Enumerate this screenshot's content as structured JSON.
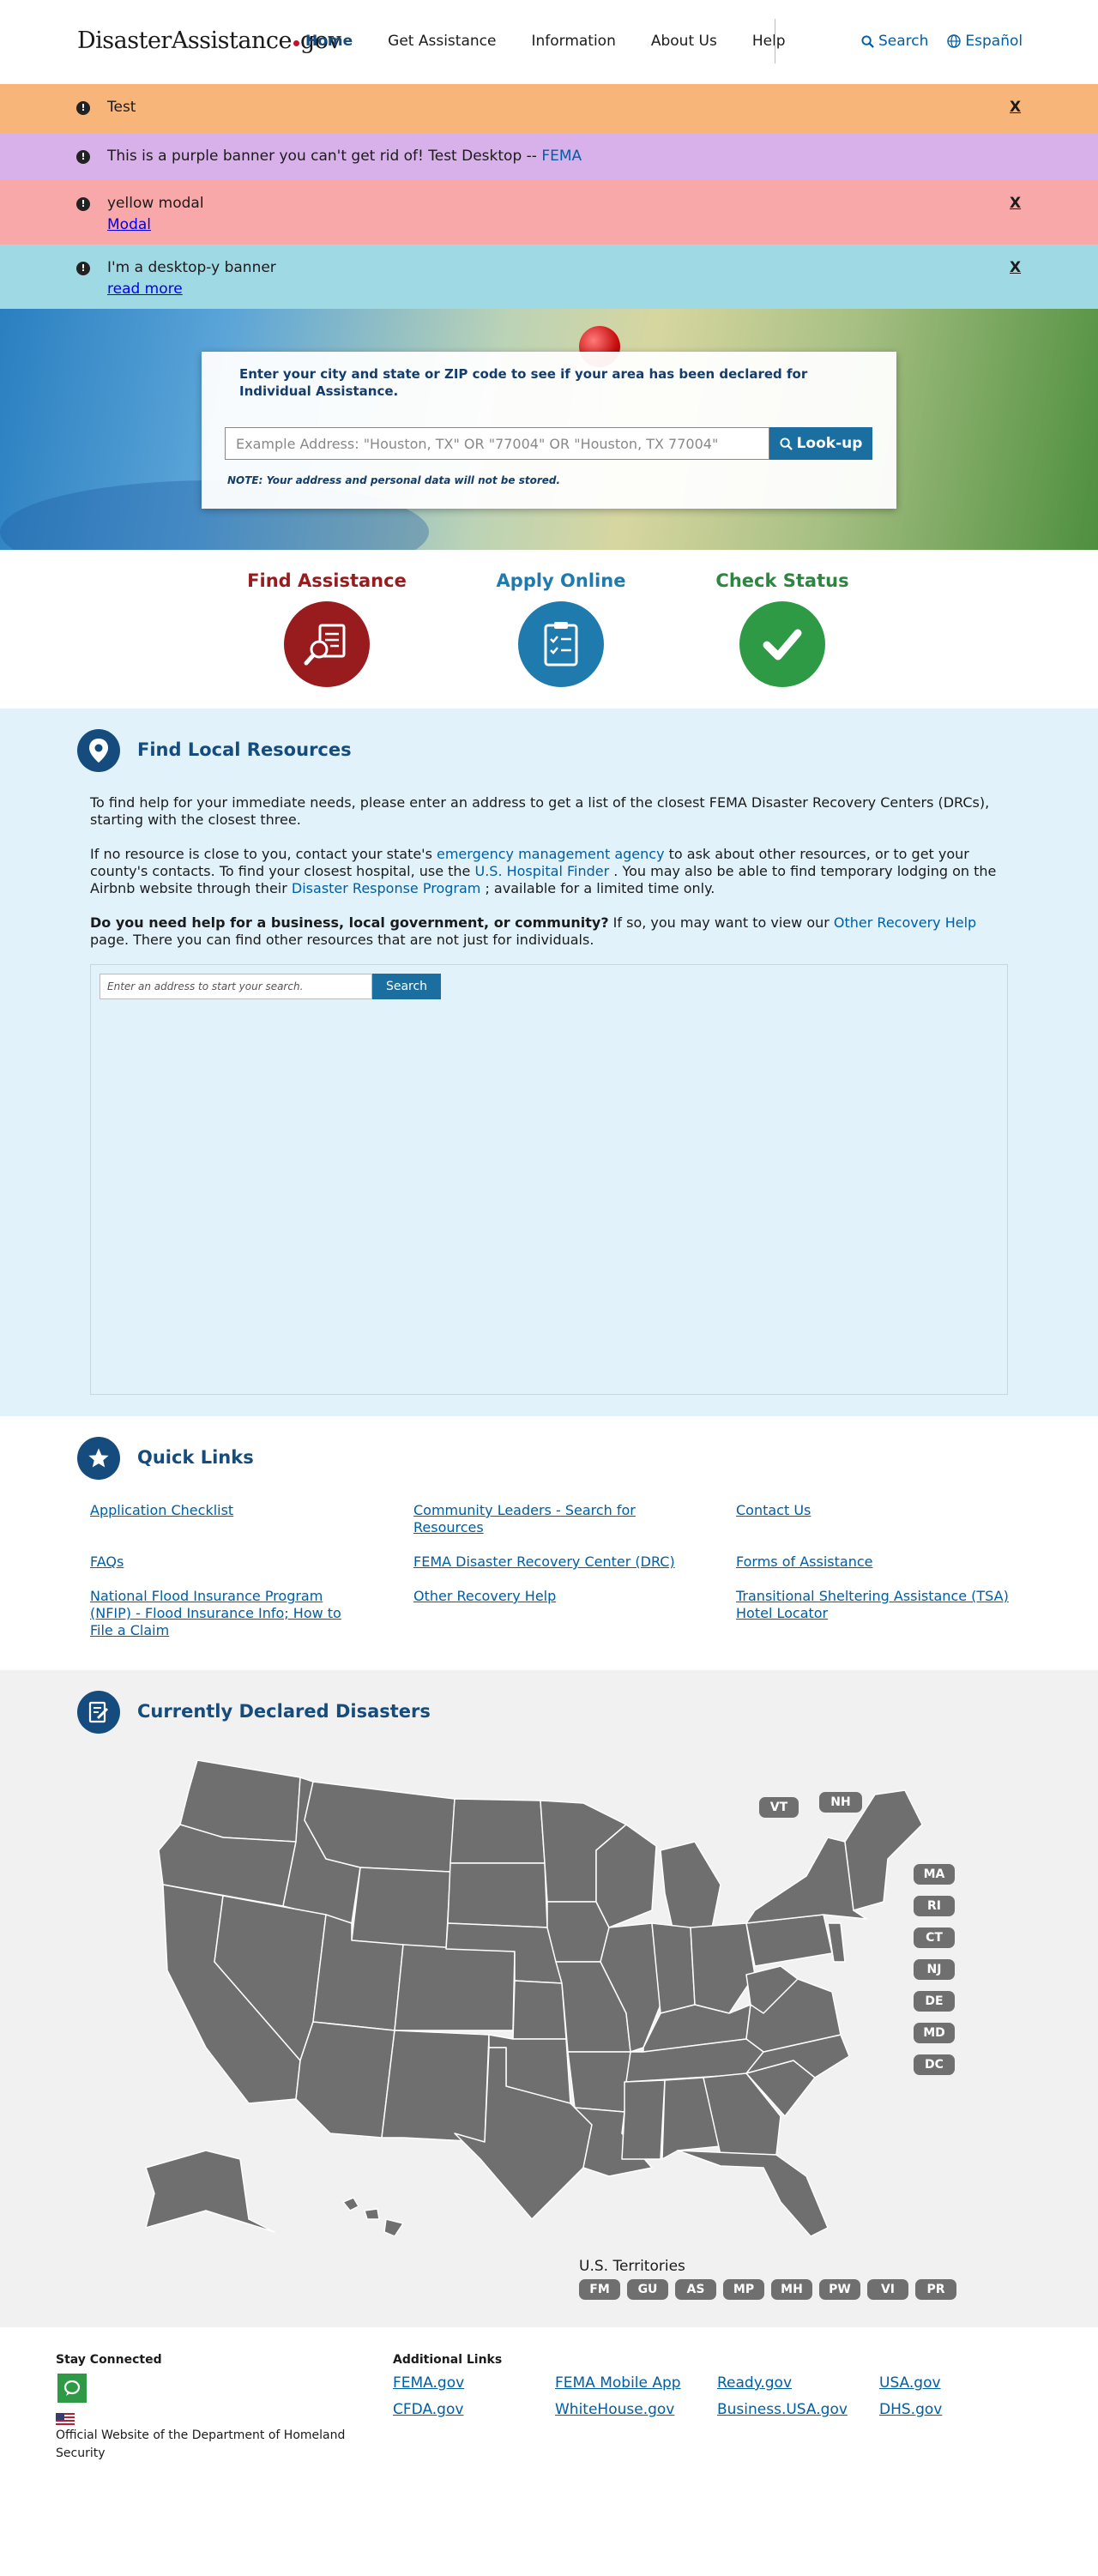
{
  "header": {
    "logo_main": "DisasterAssistance",
    "logo_suffix": "gov",
    "nav": [
      "Home",
      "Get Assistance",
      "Information",
      "About Us",
      "Help"
    ],
    "search_label": "Search",
    "language_label": "Español"
  },
  "banners": [
    {
      "text": "Test",
      "close": "X",
      "color": "#f8b57a"
    },
    {
      "text": "This is a purple banner you can't get rid of! Test Desktop  --",
      "link": "FEMA",
      "color": "#d8b0ea"
    },
    {
      "text": "yellow modal",
      "link": "Modal",
      "close": "X",
      "color": "#f8a8a8"
    },
    {
      "text": "I'm a desktop-y banner",
      "link": "read more",
      "close": "X",
      "color": "#9fd9e4"
    }
  ],
  "lookup": {
    "title": "Enter your city and state or ZIP code to see if your area has been declared for Individual Assistance.",
    "placeholder": "Example Address: \"Houston, TX\" OR \"77004\" OR \"Houston, TX 77004\"",
    "button": "Look-up",
    "note": "NOTE: Your address and personal data will not be stored."
  },
  "actions": [
    {
      "label": "Find Assistance",
      "icon": "document-search-icon",
      "color": "#981b1e"
    },
    {
      "label": "Apply Online",
      "icon": "clipboard-checklist-icon",
      "color": "#1f7bad"
    },
    {
      "label": "Check Status",
      "icon": "checkmark-icon",
      "color": "#2e8540"
    }
  ],
  "local": {
    "title": "Find Local Resources",
    "p1": "To find help for your immediate needs, please enter an address to get a list of the closest FEMA Disaster Recovery Centers (DRCs), starting with the closest three.",
    "p2_a": "If no resource is close to you, contact your state's ",
    "p2_link1": "emergency management agency ",
    "p2_b": "to ask about other resources, or to get your county's contacts. To find your closest hospital, use the ",
    "p2_link2": "U.S. Hospital Finder ",
    "p2_c": ". You may also be able to find temporary lodging on the Airbnb website through their ",
    "p2_link3": "Disaster Response Program ",
    "p2_d": "; available for a limited time only.",
    "p3_bold": "Do you need help for a business, local government, or community?",
    "p3_a": " If so, you may want to view our ",
    "p3_link": "Other Recovery Help",
    "p3_b": " page. There you can find other resources that are not just for individuals.",
    "search_placeholder": "Enter an address to start your search.",
    "search_button": "Search"
  },
  "quick_links": {
    "title": "Quick Links",
    "links": [
      "Application Checklist",
      "Community Leaders - Search for Resources",
      "Contact Us",
      "FAQs",
      "FEMA Disaster Recovery Center (DRC)",
      "Forms of Assistance",
      "National Flood Insurance Program (NFIP) - Flood Insurance Info; How to File a Claim",
      "Other Recovery Help",
      "Transitional Sheltering Assistance (TSA) Hotel Locator"
    ]
  },
  "disasters": {
    "title": "Currently Declared Disasters",
    "small_states": [
      "VT",
      "NH",
      "MA",
      "RI",
      "CT",
      "NJ",
      "DE",
      "MD",
      "DC"
    ],
    "territories_label": "U.S. Territories",
    "territories": [
      "FM",
      "GU",
      "AS",
      "MP",
      "MH",
      "PW",
      "VI",
      "PR"
    ],
    "map_color": "#6f6f6f"
  },
  "footer": {
    "stay_connected": "Stay Connected",
    "official": "Official Website of the Department of Homeland Security",
    "additional_title": "Additional Links",
    "links": [
      "FEMA.gov",
      "FEMA Mobile App",
      "Ready.gov",
      "USA.gov",
      "CFDA.gov",
      "WhiteHouse.gov",
      "Business.USA.gov",
      "DHS.gov"
    ]
  }
}
